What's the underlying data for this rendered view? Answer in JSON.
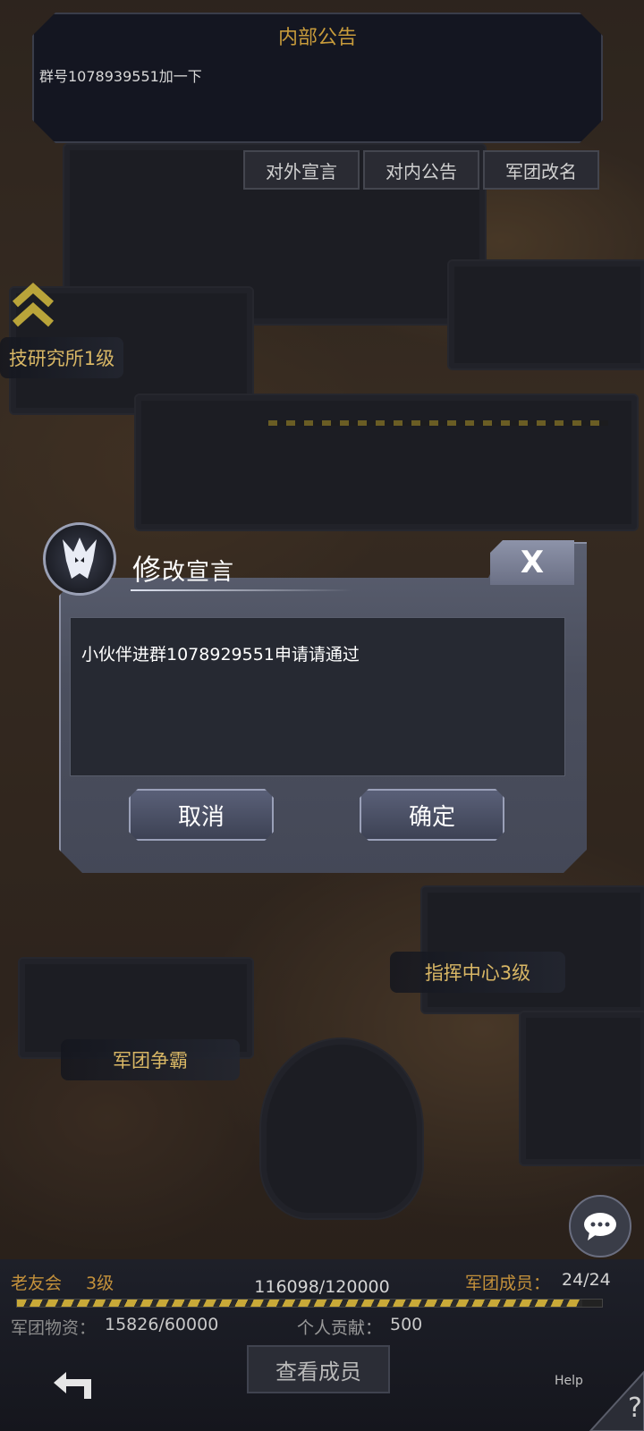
{
  "notice": {
    "title": "内部公告",
    "text": "群号1078939551加一下"
  },
  "top_buttons": [
    "对外宣言",
    "对内公告",
    "军团改名"
  ],
  "map_labels": {
    "research": "技研究所1级",
    "command": "指挥中心3级",
    "war": "军团争霸"
  },
  "modal": {
    "title_big": "修",
    "title_rest": "改宣言",
    "close": "X",
    "content": "小伙伴进群1078929551申请请通过",
    "cancel": "取消",
    "confirm": "确定"
  },
  "bottom": {
    "guild_name": "老友会",
    "guild_level": "3级",
    "exp": "116098/120000",
    "exp_progress": 0.967,
    "members_label": "军团成员：",
    "members_value": "24/24",
    "resources_label": "军团物资：",
    "resources_value": "15826/60000",
    "contribution_label": "个人贡献：",
    "contribution_value": "500",
    "view_members": "查看成员",
    "help": "Help",
    "help_mark": "?"
  }
}
